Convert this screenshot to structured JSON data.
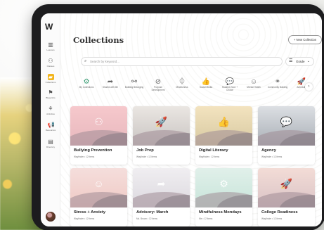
{
  "app": {
    "logo": "W"
  },
  "sidebar": {
    "items": [
      {
        "label": "Lessons",
        "icon": "book-icon",
        "glyph": "▥"
      },
      {
        "label": "Classes",
        "icon": "people-icon",
        "glyph": "⚇"
      },
      {
        "label": "Collections",
        "icon": "folder-icon",
        "glyph": "▰",
        "active": true
      },
      {
        "label": "Blueprints",
        "icon": "flag-icon",
        "glyph": "⚑"
      },
      {
        "label": "Activities",
        "icon": "activity-icon",
        "glyph": "⚘"
      },
      {
        "label": "Resources",
        "icon": "megaphone-icon",
        "glyph": "📢"
      },
      {
        "label": "Directory",
        "icon": "directory-icon",
        "glyph": "▤"
      }
    ]
  },
  "header": {
    "title": "Collections",
    "new_button": "+ New Collection"
  },
  "search": {
    "placeholder": "Search by keyword...",
    "grade_label": "Grade"
  },
  "categories": [
    {
      "label": "My Collections",
      "icon": "gear-icon",
      "glyph": "⚙"
    },
    {
      "label": "Shared with Me",
      "icon": "share-icon",
      "glyph": "➦"
    },
    {
      "label": "Building Belonging",
      "icon": "hands-icon",
      "glyph": "⚯"
    },
    {
      "label": "Purpose Development",
      "icon": "compass-icon",
      "glyph": "⊘"
    },
    {
      "label": "Mindfulness",
      "icon": "leaf-icon",
      "glyph": "⏀"
    },
    {
      "label": "Social Media",
      "icon": "thumbs-up-icon",
      "glyph": "👍"
    },
    {
      "label": "Student Voice + Choice",
      "icon": "chat-icon",
      "glyph": "💬"
    },
    {
      "label": "Mental Health",
      "icon": "head-icon",
      "glyph": "☺"
    },
    {
      "label": "Community Building",
      "icon": "community-icon",
      "glyph": "⚭"
    },
    {
      "label": "Anti-Bully",
      "icon": "rocket-icon",
      "glyph": "🚀"
    }
  ],
  "cards": [
    {
      "title": "Bullying Prevention",
      "meta": "Wayfinder  •  12 items",
      "icon": "people-icon",
      "glyph": "⚇",
      "bg": [
        "#f6c8cc",
        "#e7b8bd"
      ]
    },
    {
      "title": "Job Prep",
      "meta": "Wayfinder  •  12 items",
      "icon": "rocket-icon",
      "glyph": "🚀",
      "bg": [
        "#eae6e2",
        "#c9c4c2"
      ]
    },
    {
      "title": "Digital Literacy",
      "meta": "Wayfinder  •  12 items",
      "icon": "thumbs-up-icon",
      "glyph": "👍",
      "bg": [
        "#f3e3bf",
        "#d7c9a1"
      ]
    },
    {
      "title": "Agency",
      "meta": "Wayfinder  •  12 items",
      "icon": "chat-icon",
      "glyph": "💬",
      "bg": [
        "#dcdfe3",
        "#a9afb6"
      ]
    },
    {
      "title": "Stress + Anxiety",
      "meta": "Wayfinder  •  12 items",
      "icon": "head-icon",
      "glyph": "☺",
      "bg": [
        "#f5dedc",
        "#efc9c4"
      ]
    },
    {
      "title": "Advisory: March",
      "meta": "Ms. Brown  •  12 items",
      "icon": "share-icon",
      "glyph": "➦",
      "bg": [
        "#f0eef1",
        "#dcd9df"
      ]
    },
    {
      "title": "Mindfulness Mondays",
      "meta": "Me  •  12 items",
      "icon": "gear-icon",
      "glyph": "⚙",
      "bg": [
        "#e1f0ea",
        "#c7e4d9"
      ]
    },
    {
      "title": "College Readiness",
      "meta": "Wayfinder  •  12 items",
      "icon": "rocket-icon",
      "glyph": "🚀",
      "bg": [
        "#f3dcd6",
        "#d9c3c6"
      ]
    }
  ]
}
